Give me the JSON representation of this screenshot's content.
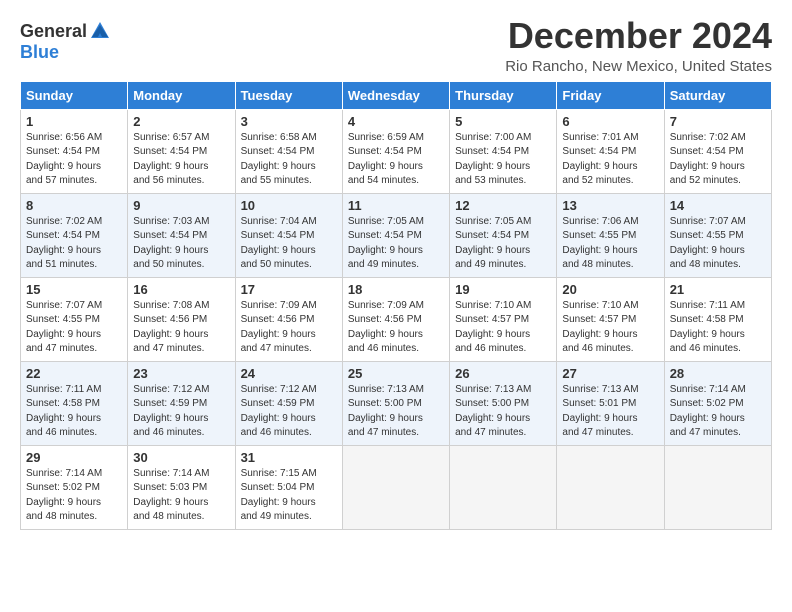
{
  "header": {
    "logo_general": "General",
    "logo_blue": "Blue",
    "title": "December 2024",
    "subtitle": "Rio Rancho, New Mexico, United States"
  },
  "days_of_week": [
    "Sunday",
    "Monday",
    "Tuesday",
    "Wednesday",
    "Thursday",
    "Friday",
    "Saturday"
  ],
  "weeks": [
    [
      {
        "day": 1,
        "info": "Sunrise: 6:56 AM\nSunset: 4:54 PM\nDaylight: 9 hours\nand 57 minutes."
      },
      {
        "day": 2,
        "info": "Sunrise: 6:57 AM\nSunset: 4:54 PM\nDaylight: 9 hours\nand 56 minutes."
      },
      {
        "day": 3,
        "info": "Sunrise: 6:58 AM\nSunset: 4:54 PM\nDaylight: 9 hours\nand 55 minutes."
      },
      {
        "day": 4,
        "info": "Sunrise: 6:59 AM\nSunset: 4:54 PM\nDaylight: 9 hours\nand 54 minutes."
      },
      {
        "day": 5,
        "info": "Sunrise: 7:00 AM\nSunset: 4:54 PM\nDaylight: 9 hours\nand 53 minutes."
      },
      {
        "day": 6,
        "info": "Sunrise: 7:01 AM\nSunset: 4:54 PM\nDaylight: 9 hours\nand 52 minutes."
      },
      {
        "day": 7,
        "info": "Sunrise: 7:02 AM\nSunset: 4:54 PM\nDaylight: 9 hours\nand 52 minutes."
      }
    ],
    [
      {
        "day": 8,
        "info": "Sunrise: 7:02 AM\nSunset: 4:54 PM\nDaylight: 9 hours\nand 51 minutes."
      },
      {
        "day": 9,
        "info": "Sunrise: 7:03 AM\nSunset: 4:54 PM\nDaylight: 9 hours\nand 50 minutes."
      },
      {
        "day": 10,
        "info": "Sunrise: 7:04 AM\nSunset: 4:54 PM\nDaylight: 9 hours\nand 50 minutes."
      },
      {
        "day": 11,
        "info": "Sunrise: 7:05 AM\nSunset: 4:54 PM\nDaylight: 9 hours\nand 49 minutes."
      },
      {
        "day": 12,
        "info": "Sunrise: 7:05 AM\nSunset: 4:54 PM\nDaylight: 9 hours\nand 49 minutes."
      },
      {
        "day": 13,
        "info": "Sunrise: 7:06 AM\nSunset: 4:55 PM\nDaylight: 9 hours\nand 48 minutes."
      },
      {
        "day": 14,
        "info": "Sunrise: 7:07 AM\nSunset: 4:55 PM\nDaylight: 9 hours\nand 48 minutes."
      }
    ],
    [
      {
        "day": 15,
        "info": "Sunrise: 7:07 AM\nSunset: 4:55 PM\nDaylight: 9 hours\nand 47 minutes."
      },
      {
        "day": 16,
        "info": "Sunrise: 7:08 AM\nSunset: 4:56 PM\nDaylight: 9 hours\nand 47 minutes."
      },
      {
        "day": 17,
        "info": "Sunrise: 7:09 AM\nSunset: 4:56 PM\nDaylight: 9 hours\nand 47 minutes."
      },
      {
        "day": 18,
        "info": "Sunrise: 7:09 AM\nSunset: 4:56 PM\nDaylight: 9 hours\nand 46 minutes."
      },
      {
        "day": 19,
        "info": "Sunrise: 7:10 AM\nSunset: 4:57 PM\nDaylight: 9 hours\nand 46 minutes."
      },
      {
        "day": 20,
        "info": "Sunrise: 7:10 AM\nSunset: 4:57 PM\nDaylight: 9 hours\nand 46 minutes."
      },
      {
        "day": 21,
        "info": "Sunrise: 7:11 AM\nSunset: 4:58 PM\nDaylight: 9 hours\nand 46 minutes."
      }
    ],
    [
      {
        "day": 22,
        "info": "Sunrise: 7:11 AM\nSunset: 4:58 PM\nDaylight: 9 hours\nand 46 minutes."
      },
      {
        "day": 23,
        "info": "Sunrise: 7:12 AM\nSunset: 4:59 PM\nDaylight: 9 hours\nand 46 minutes."
      },
      {
        "day": 24,
        "info": "Sunrise: 7:12 AM\nSunset: 4:59 PM\nDaylight: 9 hours\nand 46 minutes."
      },
      {
        "day": 25,
        "info": "Sunrise: 7:13 AM\nSunset: 5:00 PM\nDaylight: 9 hours\nand 47 minutes."
      },
      {
        "day": 26,
        "info": "Sunrise: 7:13 AM\nSunset: 5:00 PM\nDaylight: 9 hours\nand 47 minutes."
      },
      {
        "day": 27,
        "info": "Sunrise: 7:13 AM\nSunset: 5:01 PM\nDaylight: 9 hours\nand 47 minutes."
      },
      {
        "day": 28,
        "info": "Sunrise: 7:14 AM\nSunset: 5:02 PM\nDaylight: 9 hours\nand 47 minutes."
      }
    ],
    [
      {
        "day": 29,
        "info": "Sunrise: 7:14 AM\nSunset: 5:02 PM\nDaylight: 9 hours\nand 48 minutes."
      },
      {
        "day": 30,
        "info": "Sunrise: 7:14 AM\nSunset: 5:03 PM\nDaylight: 9 hours\nand 48 minutes."
      },
      {
        "day": 31,
        "info": "Sunrise: 7:15 AM\nSunset: 5:04 PM\nDaylight: 9 hours\nand 49 minutes."
      },
      null,
      null,
      null,
      null
    ]
  ]
}
